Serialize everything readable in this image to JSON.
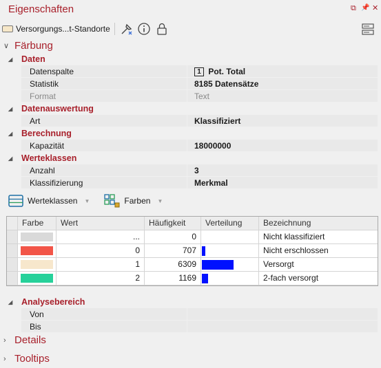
{
  "window": {
    "title": "Eigenschaften",
    "controls": [
      "⧉",
      "📌",
      "✕"
    ]
  },
  "toolbar": {
    "layer_label": "Versorgungs...t-Standorte",
    "icons": [
      "pick-tool-icon",
      "info-icon",
      "lock-icon",
      "panel-layout-icon"
    ]
  },
  "faerbung": {
    "label": "Färbung",
    "sections": {
      "daten": "Daten",
      "datenauswertung": "Datenauswertung",
      "berechnung": "Berechnung",
      "werteklassen": "Werteklassen",
      "analysebereich": "Analysebereich"
    },
    "props": {
      "datenspalte": {
        "name": "Datenspalte",
        "badge": "1",
        "value": "Pot. Total"
      },
      "statistik": {
        "name": "Statistik",
        "value": "8185 Datensätze"
      },
      "format": {
        "name": "Format",
        "value": "Text"
      },
      "art": {
        "name": "Art",
        "value": "Klassifiziert"
      },
      "kapazitaet": {
        "name": "Kapazität",
        "value": "18000000"
      },
      "anzahl": {
        "name": "Anzahl",
        "value": "3"
      },
      "klassifizierung": {
        "name": "Klassifizierung",
        "value": "Merkmal"
      },
      "von": {
        "name": "Von",
        "value": ""
      },
      "bis": {
        "name": "Bis",
        "value": ""
      }
    },
    "classes_toolbar": {
      "werteklassen_label": "Werteklassen",
      "farben_label": "Farben"
    },
    "table": {
      "headers": {
        "farbe": "Farbe",
        "wert": "Wert",
        "haeufigkeit": "Häufigkeit",
        "verteilung": "Verteilung",
        "bezeichnung": "Bezeichnung"
      },
      "rows": [
        {
          "color": "#d9d9d9",
          "wert": "...",
          "haeufigkeit": "0",
          "verteilung": 0,
          "bezeichnung": "Nicht klassifiziert"
        },
        {
          "color": "#f25548",
          "wert": "0",
          "haeufigkeit": "707",
          "verteilung": 707,
          "bezeichnung": "Nicht erschlossen"
        },
        {
          "color": "#f7e7cc",
          "wert": "1",
          "haeufigkeit": "6309",
          "verteilung": 6309,
          "bezeichnung": "Versorgt"
        },
        {
          "color": "#26d19a",
          "wert": "2",
          "haeufigkeit": "1169",
          "verteilung": 1169,
          "bezeichnung": "2-fach versorgt"
        }
      ],
      "bar_color": "#0011ff"
    }
  },
  "links": {
    "details": "Details",
    "tooltips": "Tooltips"
  }
}
